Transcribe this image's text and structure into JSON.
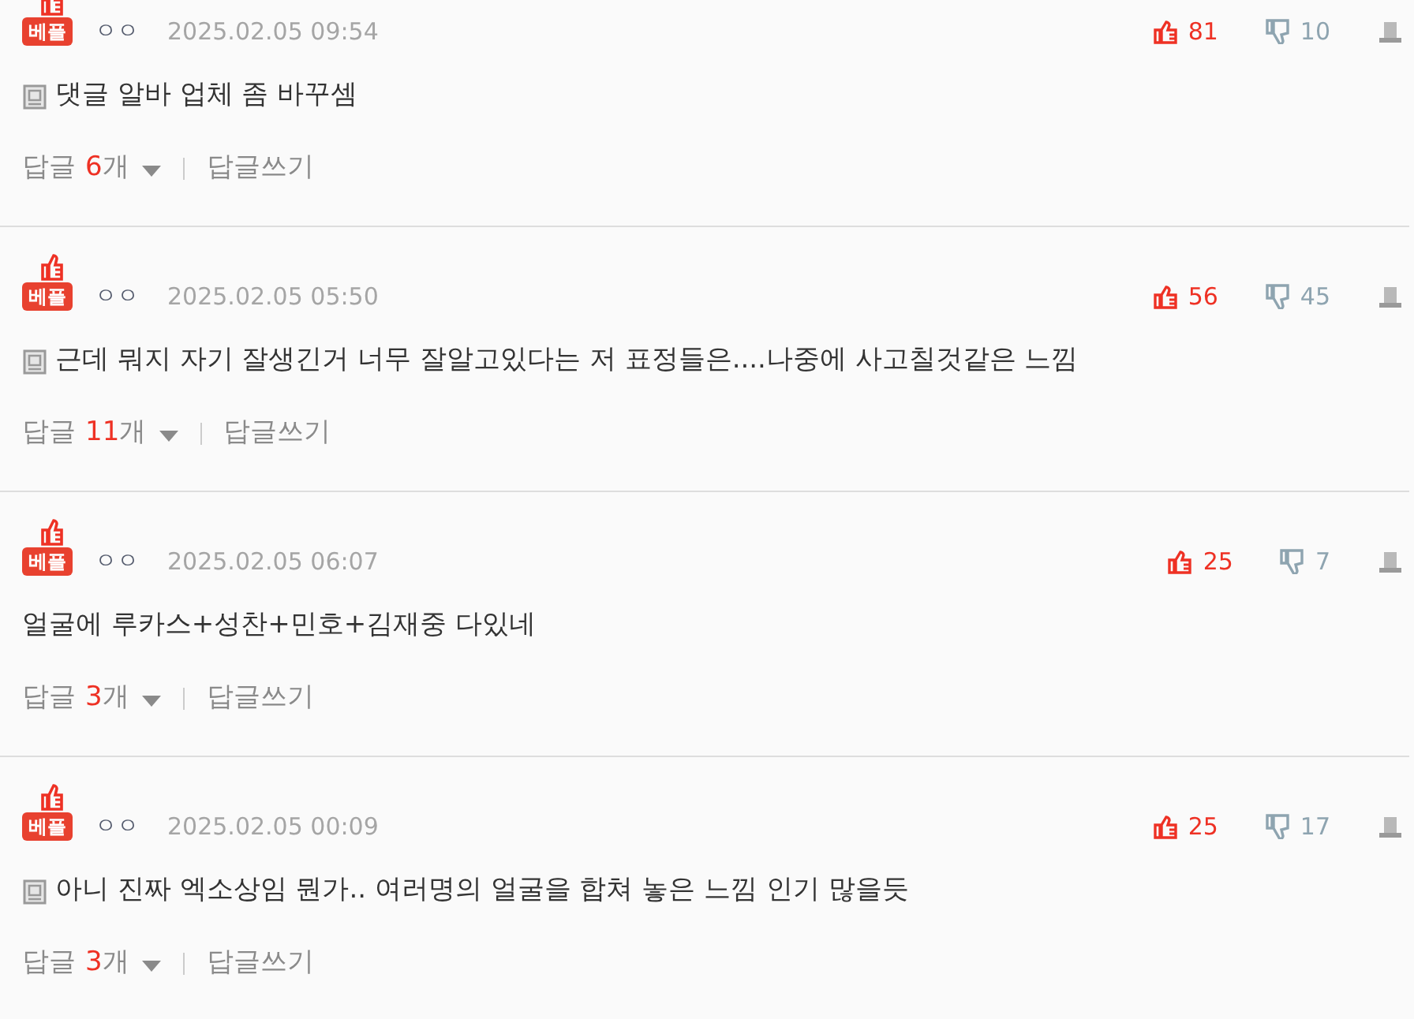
{
  "comments": [
    {
      "badge": "베플",
      "author": "ㅇㅇ",
      "date": "2025.02.05 09:54",
      "up": "81",
      "down": "10",
      "memo_icon": true,
      "text": "댓글 알바 업체 좀 바꾸셈",
      "reply_label": "답글",
      "reply_count": "6",
      "reply_unit": "개",
      "write_reply": "답글쓰기"
    },
    {
      "badge": "베플",
      "author": "ㅇㅇ",
      "date": "2025.02.05 05:50",
      "up": "56",
      "down": "45",
      "memo_icon": true,
      "text": "근데 뭐지 자기 잘생긴거 너무 잘알고있다는 저 표정들은....나중에 사고칠것같은 느낌",
      "reply_label": "답글",
      "reply_count": "11",
      "reply_unit": "개",
      "write_reply": "답글쓰기"
    },
    {
      "badge": "베플",
      "author": "ㅇㅇ",
      "date": "2025.02.05 06:07",
      "up": "25",
      "down": "7",
      "memo_icon": false,
      "text": "얼굴에 루카스+성찬+민호+김재중 다있네",
      "reply_label": "답글",
      "reply_count": "3",
      "reply_unit": "개",
      "write_reply": "답글쓰기"
    },
    {
      "badge": "베플",
      "author": "ㅇㅇ",
      "date": "2025.02.05 00:09",
      "up": "25",
      "down": "17",
      "memo_icon": true,
      "text": "아니 진짜 엑소상임 뭔가.. 여러명의 얼굴을 합쳐 놓은 느낌 인기 많을듯",
      "reply_label": "답글",
      "reply_count": "3",
      "reply_unit": "개",
      "write_reply": "답글쓰기"
    }
  ]
}
